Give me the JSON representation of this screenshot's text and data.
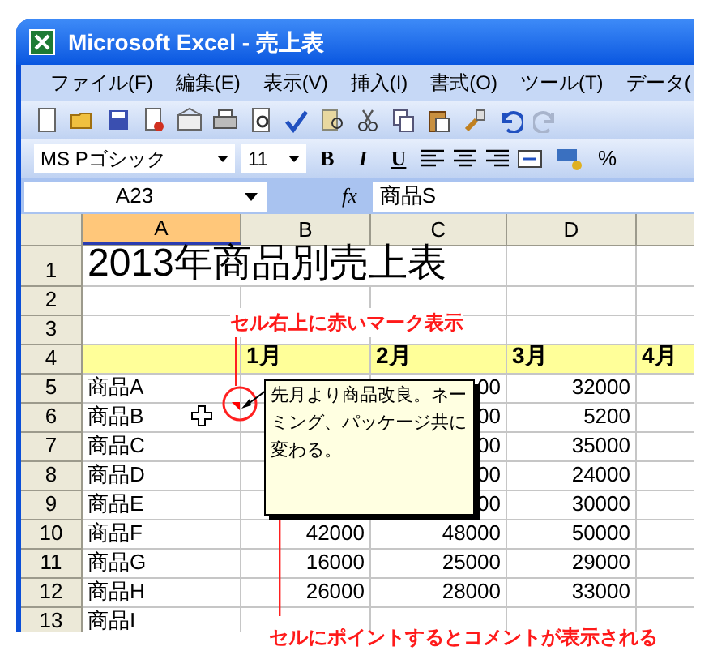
{
  "window": {
    "title": "Microsoft Excel - 売上表"
  },
  "menu": [
    "ファイル(F)",
    "編集(E)",
    "表示(V)",
    "挿入(I)",
    "書式(O)",
    "ツール(T)",
    "データ("
  ],
  "format_toolbar": {
    "font": "MS Pゴシック",
    "size": "11",
    "styles": [
      "B",
      "I",
      "U"
    ],
    "percent": "%"
  },
  "formula_bar": {
    "name_box": "A23",
    "function_label": "fx",
    "value": "商品S"
  },
  "columns": [
    {
      "label": "A",
      "selected": true
    },
    {
      "label": "B",
      "selected": false
    },
    {
      "label": "C",
      "selected": false
    },
    {
      "label": "D",
      "selected": false
    }
  ],
  "rows": [
    {
      "number": "1",
      "kind": "title",
      "cells": {
        "A": "2013年商品別売上表"
      }
    },
    {
      "number": "2",
      "kind": "blank",
      "cells": {}
    },
    {
      "number": "3",
      "kind": "blank",
      "cells": {}
    },
    {
      "number": "4",
      "kind": "header",
      "cells": {
        "B": "1月",
        "C": "2月",
        "D": "3月",
        "E": "4月"
      }
    },
    {
      "number": "5",
      "kind": "data",
      "cells": {
        "A": "商品A",
        "C": "00",
        "D": "32000"
      }
    },
    {
      "number": "6",
      "kind": "data",
      "cells": {
        "A": "商品B",
        "C": "00",
        "D": "5200"
      }
    },
    {
      "number": "7",
      "kind": "data",
      "cells": {
        "A": "商品C",
        "C": "00",
        "D": "35000"
      }
    },
    {
      "number": "8",
      "kind": "data",
      "cells": {
        "A": "商品D",
        "C": "00",
        "D": "24000"
      }
    },
    {
      "number": "9",
      "kind": "data",
      "cells": {
        "A": "商品E",
        "C": "00",
        "D": "30000"
      }
    },
    {
      "number": "10",
      "kind": "data",
      "cells": {
        "A": "商品F",
        "B": "42000",
        "C": "48000",
        "D": "50000"
      }
    },
    {
      "number": "11",
      "kind": "data",
      "cells": {
        "A": "商品G",
        "B": "16000",
        "C": "25000",
        "D": "29000"
      }
    },
    {
      "number": "12",
      "kind": "data",
      "cells": {
        "A": "商品H",
        "B": "26000",
        "C": "28000",
        "D": "33000"
      }
    },
    {
      "number": "13",
      "kind": "data",
      "cells": {
        "A": "商品I"
      }
    }
  ],
  "comment": {
    "text": "先月より商品改良。ネーミング、パッケージ共に変わる。"
  },
  "callouts": [
    {
      "text": "セル右上に赤いマーク表示"
    },
    {
      "text": "セルにポイントするとコメントが表示される"
    }
  ]
}
